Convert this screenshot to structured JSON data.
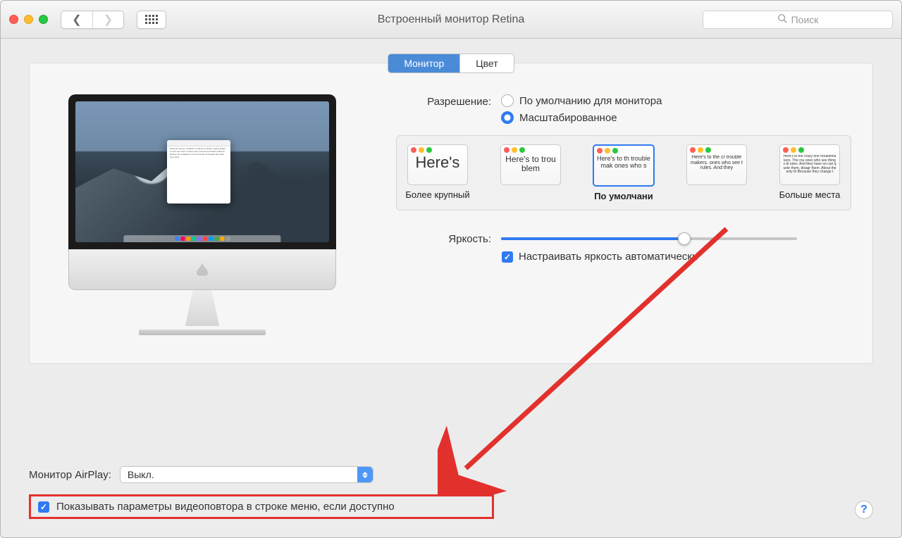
{
  "window": {
    "title": "Встроенный монитор Retina",
    "search_placeholder": "Поиск"
  },
  "tabs": {
    "display": "Монитор",
    "color": "Цвет"
  },
  "resolution": {
    "label": "Разрешение:",
    "option_default": "По умолчанию для монитора",
    "option_scaled": "Масштабированное"
  },
  "scale_options": [
    {
      "label": "Более крупный",
      "preview_text": "Here's",
      "preview_size": "22px"
    },
    {
      "label": "",
      "preview_text": "Here's to troublem",
      "preview_size": "12px"
    },
    {
      "label": "По умолчани",
      "preview_text": "Here's to th troublemak ones who s",
      "preview_size": "9px",
      "selected": true
    },
    {
      "label": "",
      "preview_text": "Here's to the cr troublemakers. ones who see t rules. And they",
      "preview_size": "7px"
    },
    {
      "label": "Больше места",
      "preview_text": "Here's to the crazy one troublemakers. The rou ones who see things di rules. And they have no can quote them, disagr them. About the only th Because they change t",
      "preview_size": "5px"
    }
  ],
  "brightness": {
    "label": "Яркость:",
    "auto_label": "Настраивать яркость автоматически"
  },
  "airplay": {
    "label": "Монитор AirPlay:",
    "value": "Выкл."
  },
  "mirror": {
    "label": "Показывать параметры видеоповтора в строке меню, если доступно"
  }
}
